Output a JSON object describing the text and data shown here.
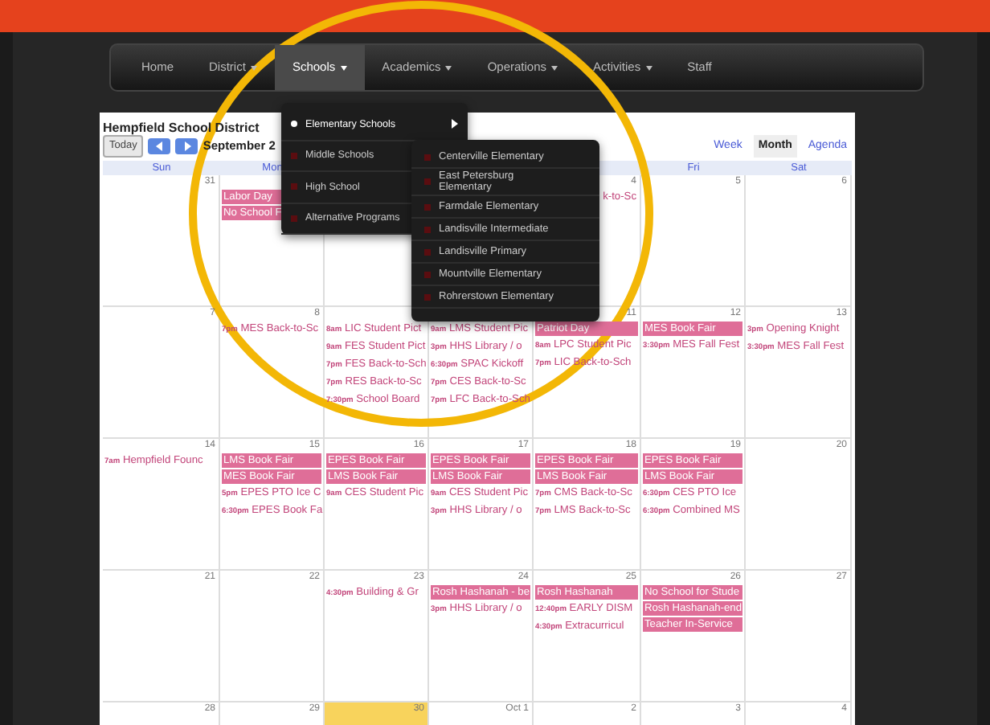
{
  "nav": [
    {
      "label": "Home",
      "dropdown": false,
      "selected": false
    },
    {
      "label": "District",
      "dropdown": true,
      "selected": false
    },
    {
      "label": "Schools",
      "dropdown": true,
      "selected": true
    },
    {
      "label": "Academics",
      "dropdown": true,
      "selected": false
    },
    {
      "label": "Operations",
      "dropdown": true,
      "selected": false
    },
    {
      "label": "Activities",
      "dropdown": true,
      "selected": false
    },
    {
      "label": "Staff",
      "dropdown": false,
      "selected": false
    }
  ],
  "schools_menu": [
    {
      "label": "Elementary Schools",
      "selected": true,
      "submenu": true
    },
    {
      "label": "Middle Schools",
      "selected": false,
      "submenu": false
    },
    {
      "label": "High School",
      "selected": false,
      "submenu": false
    },
    {
      "label": "Alternative Programs",
      "selected": false,
      "submenu": false
    }
  ],
  "elementary_menu": [
    "Centerville Elementary",
    "East Petersburg Elementary",
    "Farmdale Elementary",
    "Landisville Intermediate",
    "Landisville Primary",
    "Mountville Elementary",
    "Rohrerstown Elementary"
  ],
  "calendar": {
    "title": "Hempfield School District",
    "today_button": "Today",
    "period": "September 2",
    "views": [
      {
        "label": "Week",
        "selected": false
      },
      {
        "label": "Month",
        "selected": true
      },
      {
        "label": "Agenda",
        "selected": false
      }
    ],
    "weekdays": {
      "sun": "Sun",
      "mon": "Mon",
      "fri": "Fri",
      "sat": "Sat"
    },
    "weeks": [
      {
        "sun": {
          "day": "31",
          "today": false
        },
        "mon": {
          "today": false,
          "events": [
            {
              "kind": "block",
              "title": "Labor Day"
            },
            {
              "kind": "block",
              "title": "No School F"
            }
          ]
        },
        "tue": {
          "today": false
        },
        "thu": {
          "day": "4",
          "today": false,
          "events": [
            {
              "kind": "fragment",
              "title": "k-to-Sc"
            }
          ]
        },
        "fri": {
          "day": "5",
          "today": false
        },
        "sat": {
          "day": "6",
          "today": false
        }
      },
      {
        "sun": {
          "day": "7",
          "today": false
        },
        "mon": {
          "day": "8",
          "today": false,
          "events": [
            {
              "kind": "timed",
              "time": "7pm",
              "title": "MES Back-to-Sc"
            }
          ]
        },
        "tue": {
          "today": false,
          "events": [
            {
              "kind": "timed",
              "time": "8am",
              "title": "LIC Student Pict"
            },
            {
              "kind": "timed",
              "time": "9am",
              "title": "FES Student Pict"
            },
            {
              "kind": "timed",
              "time": "7pm",
              "title": "FES Back-to-Sch"
            },
            {
              "kind": "timed",
              "time": "7pm",
              "title": "RES Back-to-Sc"
            },
            {
              "kind": "timed",
              "time": "7:30pm",
              "title": "School Board"
            }
          ]
        },
        "wed": {
          "today": false,
          "events": [
            {
              "kind": "timed",
              "time": "9am",
              "title": "LMS Student Pic"
            },
            {
              "kind": "timed",
              "time": "3pm",
              "title": "HHS Library / o"
            },
            {
              "kind": "timed",
              "time": "6:30pm",
              "title": "SPAC Kickoff"
            },
            {
              "kind": "timed",
              "time": "7pm",
              "title": "CES Back-to-Sc"
            },
            {
              "kind": "timed",
              "time": "7pm",
              "title": "LFC Back-to-Sch"
            }
          ]
        },
        "thu": {
          "day": "11",
          "today": false,
          "events": [
            {
              "kind": "block",
              "title": "Patriot Day"
            },
            {
              "kind": "timed",
              "time": "8am",
              "title": "LPC Student Pic"
            },
            {
              "kind": "timed",
              "time": "7pm",
              "title": "LIC Back-to-Sch"
            }
          ]
        },
        "fri": {
          "day": "12",
          "today": false,
          "events": [
            {
              "kind": "block",
              "title": "MES Book Fair"
            },
            {
              "kind": "timed",
              "time": "3:30pm",
              "title": "MES Fall Fest"
            }
          ]
        },
        "sat": {
          "day": "13",
          "today": false,
          "events": [
            {
              "kind": "timed",
              "time": "3pm",
              "title": "Opening Knight"
            },
            {
              "kind": "timed",
              "time": "3:30pm",
              "title": "MES Fall Fest"
            }
          ]
        }
      },
      {
        "sun": {
          "day": "14",
          "today": false,
          "events": [
            {
              "kind": "timed",
              "time": "7am",
              "title": "Hempfield Founc"
            }
          ]
        },
        "mon": {
          "day": "15",
          "today": false,
          "events": [
            {
              "kind": "block",
              "title": "LMS Book Fair"
            },
            {
              "kind": "block",
              "title": "MES Book Fair"
            },
            {
              "kind": "timed",
              "time": "5pm",
              "title": "EPES PTO Ice C"
            },
            {
              "kind": "timed",
              "time": "6:30pm",
              "title": "EPES Book Fa"
            }
          ]
        },
        "tue": {
          "day": "16",
          "today": false,
          "events": [
            {
              "kind": "block",
              "title": "EPES Book Fair"
            },
            {
              "kind": "block",
              "title": "LMS Book Fair"
            },
            {
              "kind": "timed",
              "time": "9am",
              "title": "CES Student Pic"
            }
          ]
        },
        "wed": {
          "day": "17",
          "today": false,
          "events": [
            {
              "kind": "block",
              "title": "EPES Book Fair"
            },
            {
              "kind": "block",
              "title": "LMS Book Fair"
            },
            {
              "kind": "timed",
              "time": "9am",
              "title": "CES Student Pic"
            },
            {
              "kind": "timed",
              "time": "3pm",
              "title": "HHS Library / o"
            }
          ]
        },
        "thu": {
          "day": "18",
          "today": false,
          "events": [
            {
              "kind": "block",
              "title": "EPES Book Fair"
            },
            {
              "kind": "block",
              "title": "LMS Book Fair"
            },
            {
              "kind": "timed",
              "time": "7pm",
              "title": "CMS Back-to-Sc"
            },
            {
              "kind": "timed",
              "time": "7pm",
              "title": "LMS Back-to-Sc"
            }
          ]
        },
        "fri": {
          "day": "19",
          "today": false,
          "events": [
            {
              "kind": "block",
              "title": "EPES Book Fair"
            },
            {
              "kind": "block",
              "title": "LMS Book Fair"
            },
            {
              "kind": "timed",
              "time": "6:30pm",
              "title": "CES PTO Ice"
            },
            {
              "kind": "timed",
              "time": "6:30pm",
              "title": "Combined MS"
            }
          ]
        },
        "sat": {
          "day": "20",
          "today": false
        }
      },
      {
        "sun": {
          "day": "21",
          "today": false
        },
        "mon": {
          "day": "22",
          "today": false
        },
        "tue": {
          "day": "23",
          "today": false,
          "events": [
            {
              "kind": "timed",
              "time": "4:30pm",
              "title": "Building & Gr"
            }
          ]
        },
        "wed": {
          "day": "24",
          "today": false,
          "events": [
            {
              "kind": "block",
              "title": "Rosh Hashanah - be"
            },
            {
              "kind": "timed",
              "time": "3pm",
              "title": "HHS Library / o"
            }
          ]
        },
        "thu": {
          "day": "25",
          "today": false,
          "events": [
            {
              "kind": "block",
              "title": "Rosh Hashanah"
            },
            {
              "kind": "timed",
              "time": "12:40pm",
              "title": "EARLY DISM"
            },
            {
              "kind": "timed",
              "time": "4:30pm",
              "title": "Extracurricul"
            }
          ]
        },
        "fri": {
          "day": "26",
          "today": false,
          "events": [
            {
              "kind": "block",
              "title": "No School for Stude"
            },
            {
              "kind": "block",
              "title": "Rosh Hashanah-end"
            },
            {
              "kind": "block",
              "title": "Teacher In-Service"
            }
          ]
        },
        "sat": {
          "day": "27",
          "today": false
        }
      },
      {
        "sun": {
          "day": "28",
          "today": false
        },
        "mon": {
          "day": "29",
          "today": false
        },
        "tue": {
          "day": "30",
          "today": true
        },
        "wed": {
          "day": "Oct 1",
          "today": false
        },
        "thu": {
          "day": "2",
          "today": false
        },
        "fri": {
          "day": "3",
          "today": false
        },
        "sat": {
          "day": "4",
          "today": false
        }
      }
    ]
  }
}
